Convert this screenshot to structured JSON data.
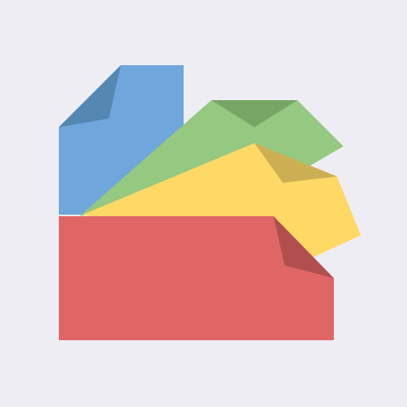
{
  "icon": {
    "name": "stacked-documents-icon",
    "colors": {
      "background": "#efedf4",
      "blue": "#6fa6dc",
      "blue_fold": "#5587b3",
      "green": "#95c880",
      "green_fold": "#76a565",
      "yellow": "#ffd966",
      "yellow_fold": "#cdaf53",
      "red": "#e06666",
      "red_fold": "#b14f50"
    }
  }
}
